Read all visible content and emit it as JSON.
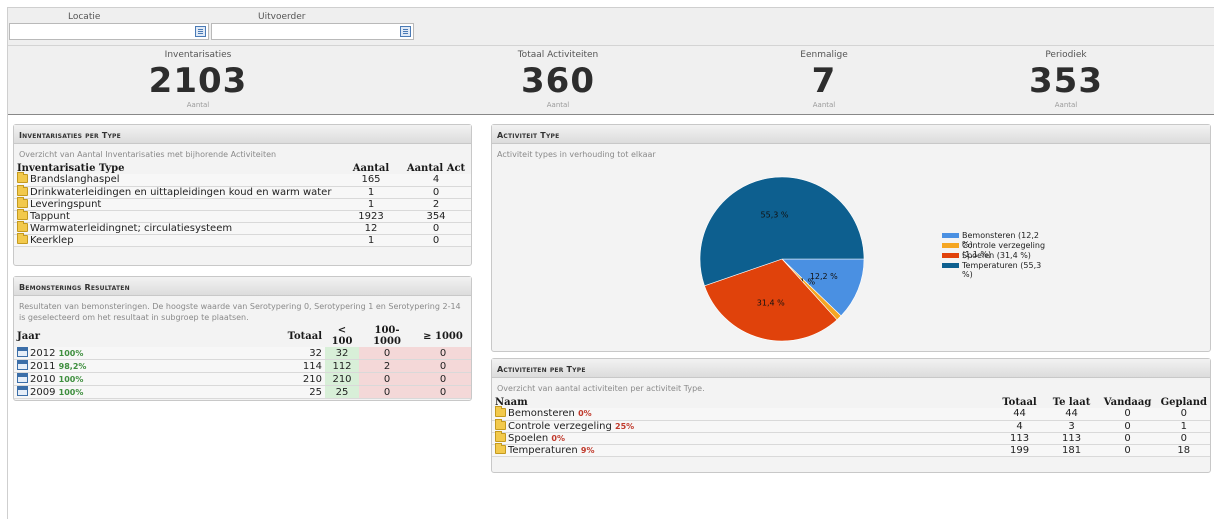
{
  "filters": {
    "location_label": "Locatie",
    "executor_label": "Uitvoerder",
    "location_value": "",
    "executor_value": ""
  },
  "kpis": [
    {
      "title": "Inventarisaties",
      "value": "2103",
      "unit": "Aantal"
    },
    {
      "title": "Totaal Activiteiten",
      "value": "360",
      "unit": "Aantal"
    },
    {
      "title": "Eenmalige",
      "value": "7",
      "unit": "Aantal"
    },
    {
      "title": "Periodiek",
      "value": "353",
      "unit": "Aantal"
    }
  ],
  "inventory_panel": {
    "title": "Inventarisaties per Type",
    "description": "Overzicht van Aantal Inventarisaties met bijhorende Activiteiten",
    "headers": [
      "Inventarisatie Type",
      "Aantal",
      "Aantal Act"
    ],
    "rows": [
      {
        "name": "Brandslanghaspel",
        "count": "165",
        "act": "4"
      },
      {
        "name": "Drinkwaterleidingen en uittapleidingen koud en warm water",
        "count": "1",
        "act": "0"
      },
      {
        "name": "Leveringspunt",
        "count": "1",
        "act": "2"
      },
      {
        "name": "Tappunt",
        "count": "1923",
        "act": "354"
      },
      {
        "name": "Warmwaterleidingnet; circulatiesysteem",
        "count": "12",
        "act": "0"
      },
      {
        "name": "Keerklep",
        "count": "1",
        "act": "0"
      }
    ]
  },
  "sampling_panel": {
    "title": "Bemonsterings Resultaten",
    "description": "Resultaten van bemonsteringen. De hoogste waarde van Serotypering 0, Serotypering 1 en Serotypering 2-14 is geselecteerd om het resultaat in subgroep te plaatsen.",
    "headers": [
      "Jaar",
      "Totaal",
      "< 100",
      "100-1000",
      "≥ 1000"
    ],
    "rows": [
      {
        "year": "2012",
        "pct": "100%",
        "total": "32",
        "lt100": "32",
        "mid": "0",
        "gt1000": "0"
      },
      {
        "year": "2011",
        "pct": "98,2%",
        "total": "114",
        "lt100": "112",
        "mid": "2",
        "gt1000": "0"
      },
      {
        "year": "2010",
        "pct": "100%",
        "total": "210",
        "lt100": "210",
        "mid": "0",
        "gt1000": "0"
      },
      {
        "year": "2009",
        "pct": "100%",
        "total": "25",
        "lt100": "25",
        "mid": "0",
        "gt1000": "0"
      }
    ]
  },
  "activity_type_panel": {
    "title": "Activiteit Type",
    "description": "Activiteit types in verhouding tot elkaar"
  },
  "chart_data": {
    "type": "pie",
    "slices": [
      {
        "label": "Bemonsteren",
        "value": 12.2,
        "label_text": "12,2 %",
        "legend": "Bemonsteren (12,2 %)",
        "color": "#4a90e2"
      },
      {
        "label": "Controle verzegeling",
        "value": 1.1,
        "label_text": "1,1 %",
        "legend": "Controle verzegeling (1,1 %)",
        "color": "#f5a623"
      },
      {
        "label": "Spoelen",
        "value": 31.4,
        "label_text": "31,4 %",
        "legend": "Spoelen (31,4 %)",
        "color": "#e0420b"
      },
      {
        "label": "Temperaturen",
        "value": 55.3,
        "label_text": "55,3 %",
        "legend": "Temperaturen (55,3 %)",
        "color": "#0d5f8f"
      }
    ],
    "legend_position": "right"
  },
  "activities_panel": {
    "title": "Activiteiten per Type",
    "description": "Overzicht van aantal activiteiten per activiteit Type.",
    "headers": [
      "Naam",
      "Totaal",
      "Te laat",
      "Vandaag",
      "Gepland"
    ],
    "rows": [
      {
        "name": "Bemonsteren",
        "pct": "0%",
        "total": "44",
        "late": "44",
        "today": "0",
        "planned": "0"
      },
      {
        "name": "Controle verzegeling",
        "pct": "25%",
        "total": "4",
        "late": "3",
        "today": "0",
        "planned": "1"
      },
      {
        "name": "Spoelen",
        "pct": "0%",
        "total": "113",
        "late": "113",
        "today": "0",
        "planned": "0"
      },
      {
        "name": "Temperaturen",
        "pct": "9%",
        "total": "199",
        "late": "181",
        "today": "0",
        "planned": "18"
      }
    ]
  }
}
